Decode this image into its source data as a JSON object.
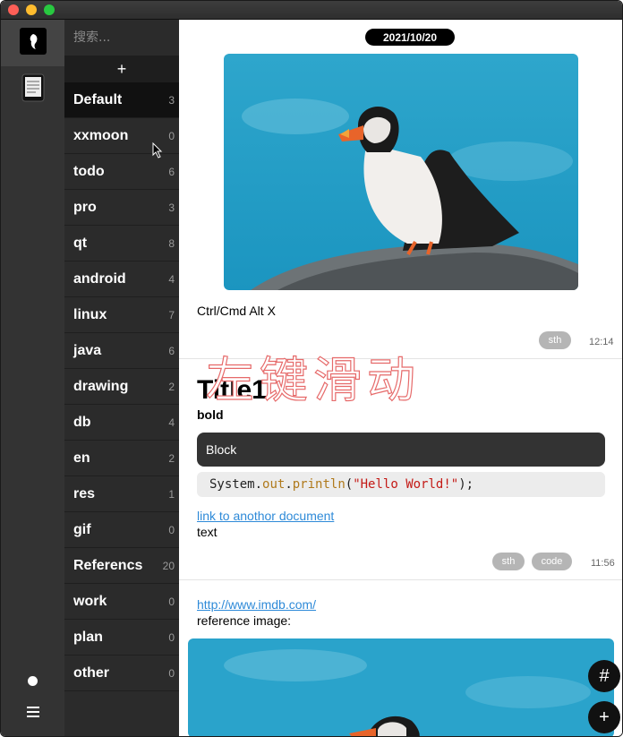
{
  "window": {
    "controls": [
      "close",
      "minimize",
      "zoom"
    ]
  },
  "rail": {
    "top_icons": [
      "feather-icon",
      "notebook-icon"
    ],
    "bottom_icons": [
      "dot-icon",
      "menu-icon"
    ]
  },
  "search": {
    "placeholder": "搜索..."
  },
  "folder_add_label": "+",
  "folders": [
    {
      "name": "Default",
      "count": "3",
      "selected": true
    },
    {
      "name": "xxmoon",
      "count": "0"
    },
    {
      "name": "todo",
      "count": "6"
    },
    {
      "name": "pro",
      "count": "3"
    },
    {
      "name": "qt",
      "count": "8"
    },
    {
      "name": "android",
      "count": "4"
    },
    {
      "name": "linux",
      "count": "7"
    },
    {
      "name": "java",
      "count": "6"
    },
    {
      "name": "drawing",
      "count": "2"
    },
    {
      "name": "db",
      "count": "4"
    },
    {
      "name": "en",
      "count": "2"
    },
    {
      "name": "res",
      "count": "1"
    },
    {
      "name": "gif",
      "count": "0"
    },
    {
      "name": "Referencs",
      "count": "20"
    },
    {
      "name": "work",
      "count": "0"
    },
    {
      "name": "plan",
      "count": "0"
    },
    {
      "name": "other",
      "count": "0"
    }
  ],
  "sliver_label": "1",
  "notes": {
    "date": "2021/10/20",
    "note1": {
      "text": "Ctrl/Cmd Alt X",
      "tags": [
        "sth"
      ],
      "time": "12:14"
    },
    "watermark": "左键滑动",
    "note2": {
      "title": "Title1",
      "bold": "bold",
      "block": "Block",
      "code": {
        "obj": "System.",
        "field": "out",
        "dot": ".",
        "method": "println",
        "open": "(",
        "str": "\"Hello World!\"",
        "close": ");"
      },
      "link": "link to anothor document",
      "text": "text",
      "tags": [
        "sth",
        "code"
      ],
      "time": "11:56"
    },
    "note3": {
      "link": "http://www.imdb.com/",
      "text": "reference image:"
    }
  },
  "fabs": {
    "tag": "#",
    "add": "+"
  },
  "colors": {
    "sidebar": "#2b2b2b",
    "rail": "#333333",
    "accent_link": "#2e8ad8",
    "watermark": "#e66a6a"
  }
}
